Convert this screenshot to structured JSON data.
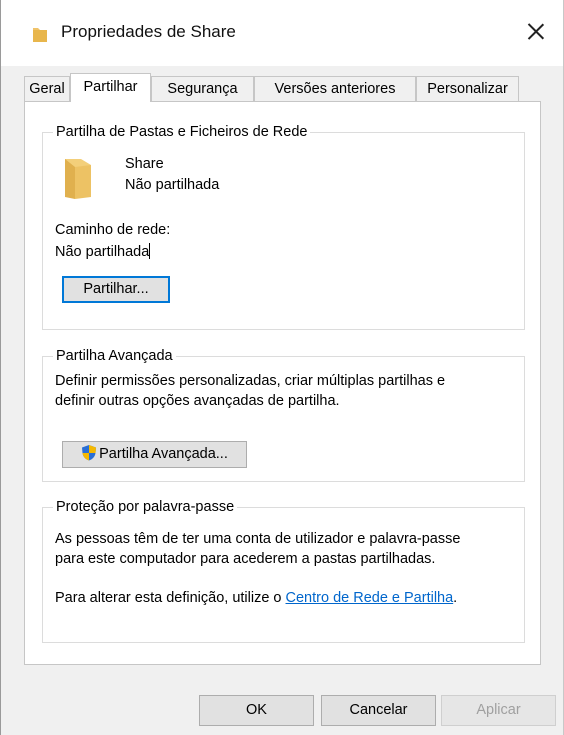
{
  "window": {
    "title": "Propriedades de Share",
    "icon": "folder-icon"
  },
  "tabs": [
    "Geral",
    "Partilhar",
    "Segurança",
    "Versões anteriores",
    "Personalizar"
  ],
  "active_tab": "Partilhar",
  "network_share": {
    "legend": "Partilha de Pastas e Ficheiros de Rede",
    "folder_name": "Share",
    "folder_status": "Não partilhada",
    "network_path_label": "Caminho de rede:",
    "network_path_value": "Não partilhada",
    "share_button": "Partilhar..."
  },
  "advanced_share": {
    "legend": "Partilha Avançada",
    "description_line1": "Definir permissões personalizadas, criar múltiplas partilhas e",
    "description_line2": "definir outras opções avançadas de partilha.",
    "button": "Partilha Avançada...",
    "button_icon": "uac-shield-icon"
  },
  "password_protection": {
    "legend": "Proteção por palavra-passe",
    "line1": "As pessoas têm de ter uma conta de utilizador e palavra-passe",
    "line2": "para este computador para acederem a pastas partilhadas.",
    "change_prefix": "Para alterar esta definição, utilize o ",
    "link_text": "Centro de Rede e Partilha",
    "change_suffix": "."
  },
  "footer": {
    "ok": "OK",
    "cancel": "Cancelar",
    "apply": "Aplicar"
  },
  "colors": {
    "accent": "#0078d7",
    "link": "#0066cc",
    "folder": "#e8c25c"
  }
}
